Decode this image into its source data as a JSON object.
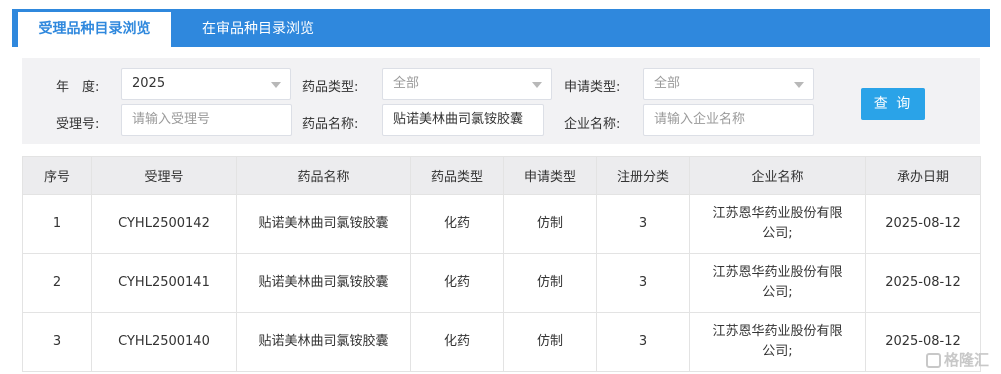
{
  "tabs": [
    {
      "label": "受理品种目录浏览",
      "active": true
    },
    {
      "label": "在审品种目录浏览",
      "active": false
    }
  ],
  "filters": {
    "year_label": "年　度:",
    "year_value": "2025",
    "drug_type_label": "药品类型:",
    "drug_type_value": "全部",
    "apply_type_label": "申请类型:",
    "apply_type_value": "全部",
    "accept_no_label": "受理号:",
    "accept_no_placeholder": "请输入受理号",
    "drug_name_label": "药品名称:",
    "drug_name_value": "贴诺美林曲司氯铵胶囊",
    "company_label": "企业名称:",
    "company_placeholder": "请输入企业名称",
    "query_label": "查 询"
  },
  "table": {
    "headers": [
      "序号",
      "受理号",
      "药品名称",
      "药品类型",
      "申请类型",
      "注册分类",
      "企业名称",
      "承办日期"
    ],
    "rows": [
      {
        "no": "1",
        "accept_no": "CYHL2500142",
        "drug_name": "贴诺美林曲司氯铵胶囊",
        "drug_type": "化药",
        "apply_type": "仿制",
        "reg_class": "3",
        "company_line1": "江苏恩华药业股份有限",
        "company_line2": "公司;",
        "date": "2025-08-12"
      },
      {
        "no": "2",
        "accept_no": "CYHL2500141",
        "drug_name": "贴诺美林曲司氯铵胶囊",
        "drug_type": "化药",
        "apply_type": "仿制",
        "reg_class": "3",
        "company_line1": "江苏恩华药业股份有限",
        "company_line2": "公司;",
        "date": "2025-08-12"
      },
      {
        "no": "3",
        "accept_no": "CYHL2500140",
        "drug_name": "贴诺美林曲司氯铵胶囊",
        "drug_type": "化药",
        "apply_type": "仿制",
        "reg_class": "3",
        "company_line1": "江苏恩华药业股份有限",
        "company_line2": "公司;",
        "date": "2025-08-12"
      }
    ]
  },
  "watermark": {
    "text": "格隆汇",
    "icon": "gelonghui-logo-icon"
  },
  "colors": {
    "tab_bar": "#2f88dd",
    "query_button": "#2aa3e8"
  }
}
